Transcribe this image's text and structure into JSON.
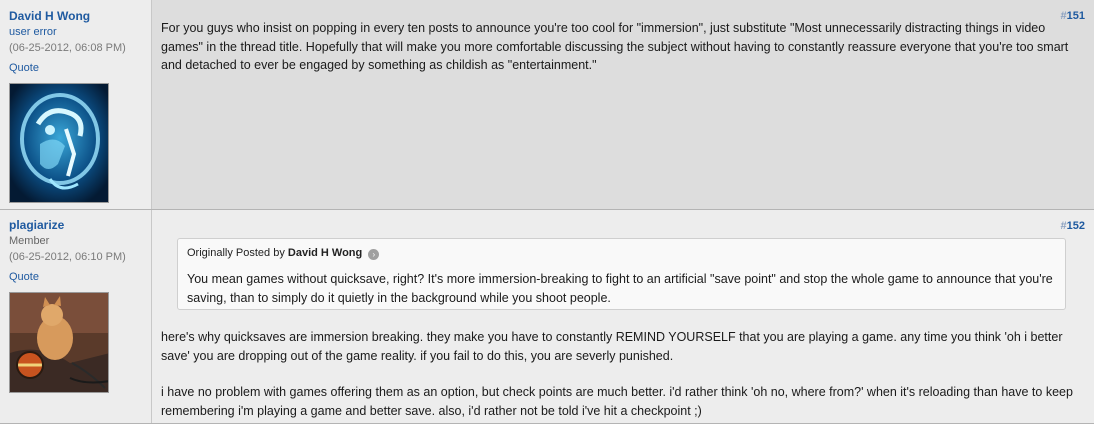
{
  "posts": [
    {
      "username": "David H Wong",
      "usertitle": "user error",
      "date": "(06-25-2012, 06:08 PM)",
      "quote_label": "Quote",
      "avatar_icon": "xray-skull-avatar",
      "post_number_hash": "#",
      "post_number": "151",
      "message": "For you guys who insist on popping in every ten posts to announce you're too cool for \"immersion\", just substitute \"Most unnecessarily distracting things in video games\" in the thread title. Hopefully that will make you more comfortable discussing the subject without having to constantly reassure everyone that you're too smart and detached to ever be engaged by something as childish as \"entertainment.\""
    },
    {
      "username": "plagiarize",
      "usertitle": "Member",
      "date": "(06-25-2012, 06:10 PM)",
      "quote_label": "Quote",
      "avatar_icon": "kitten-helmet-avatar",
      "post_number_hash": "#",
      "post_number": "152",
      "quote": {
        "prefix": "Originally Posted by",
        "author": "David H Wong",
        "view_icon": "view-post-icon",
        "text": "You mean games without quicksave, right? It's more immersion-breaking to fight to an artificial \"save point\" and stop the whole game to announce that you're saving, than to simply do it quietly in the background while you shoot people."
      },
      "message_p1": "here's why quicksaves are immersion breaking. they make you have to constantly REMIND YOURSELF that you are playing a game. any time you think 'oh i better save' you are dropping out of the game reality. if you fail to do this, you are severly punished.",
      "message_p2": "i have no problem with games offering them as an option, but check points are much better. i'd rather think 'oh no, where from?' when it's reloading than have to keep remembering i'm playing a game and better save. also, i'd rather not be told i've hit a checkpoint ;)"
    }
  ]
}
